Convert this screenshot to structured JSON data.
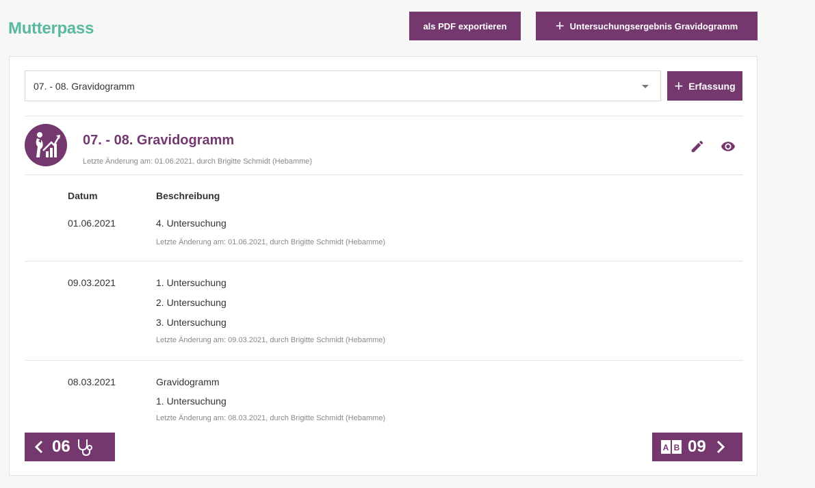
{
  "header": {
    "title": "Mutterpass",
    "pdf_button": "als PDF exportieren",
    "add_result_button": "Untersuchungsergebnis Gravidogramm"
  },
  "selector": {
    "value": "07. - 08. Gravidogramm",
    "add_button": "Erfassung"
  },
  "section": {
    "title": "07. - 08. Gravidogramm",
    "meta": "Letzte Änderung am: 01.06.2021, durch Brigitte Schmidt (Hebamme)",
    "icon": "pregnancy-chart-icon"
  },
  "table": {
    "col_date": "Datum",
    "col_desc": "Beschreibung",
    "rows": [
      {
        "date": "01.06.2021",
        "items": [
          "4. Untersuchung"
        ],
        "meta": "Letzte Änderung am: 01.06.2021, durch Brigitte Schmidt (Hebamme)"
      },
      {
        "date": "09.03.2021",
        "items": [
          "1. Untersuchung",
          "2. Untersuchung",
          "3. Untersuchung"
        ],
        "meta": "Letzte Änderung am: 09.03.2021, durch Brigitte Schmidt (Hebamme)"
      },
      {
        "date": "08.03.2021",
        "items": [
          "Gravidogramm",
          "1. Untersuchung"
        ],
        "meta": "Letzte Änderung am: 08.03.2021, durch Brigitte Schmidt (Hebamme)"
      }
    ]
  },
  "nav": {
    "prev_label": "06",
    "prev_icon": "stethoscope-icon",
    "next_label": "09",
    "next_icon": "ab-blood-type-icon"
  },
  "colors": {
    "accent": "#74386f",
    "title_green": "#58b99f"
  }
}
